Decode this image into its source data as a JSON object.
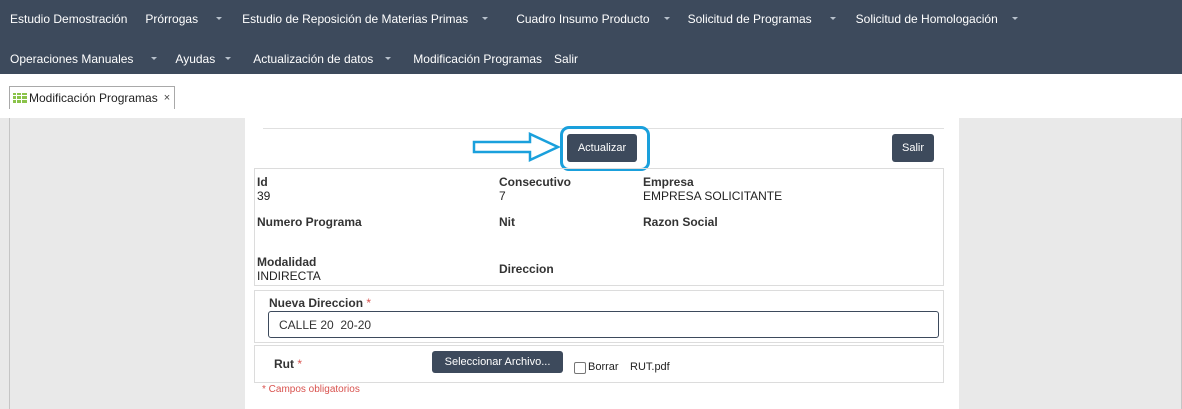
{
  "navbar": {
    "row1": [
      {
        "label": "Estudio Demostración",
        "caret": false
      },
      {
        "label": "Prórrogas",
        "caret": true
      },
      {
        "label": "Estudio de Reposición de Materias Primas",
        "caret": true
      },
      {
        "label": "Cuadro Insumo Producto",
        "caret": true
      },
      {
        "label": "Solicitud de Programas",
        "caret": true
      },
      {
        "label": "Solicitud de Homologación",
        "caret": true
      }
    ],
    "row2": [
      {
        "label": "Operaciones Manuales",
        "caret": true
      },
      {
        "label": "Ayudas",
        "caret": true
      },
      {
        "label": "Actualización de datos",
        "caret": true
      },
      {
        "label": "Modificación Programas",
        "caret": false
      },
      {
        "label": "Salir",
        "caret": false
      }
    ]
  },
  "tab": {
    "label": "Modificación Programas",
    "close": "×",
    "icon": "grid-table-icon"
  },
  "buttons": {
    "update": "Actualizar",
    "exit": "Salir",
    "select_file": "Seleccionar Archivo..."
  },
  "fields": {
    "id_label": "Id",
    "id_value": "39",
    "consecutivo_label": "Consecutivo",
    "consecutivo_value": "7",
    "empresa_label": "Empresa",
    "empresa_value": "EMPRESA SOLICITANTE",
    "numero_programa_label": "Numero Programa",
    "nit_label": "Nit",
    "razon_social_label": "Razon Social",
    "modalidad_label": "Modalidad",
    "modalidad_value": "INDIRECTA",
    "direccion_label": "Direccion",
    "nueva_direccion_label": "Nueva Direccion",
    "nueva_direccion_value": "CALLE 20  20-20",
    "rut_label": "Rut",
    "required_mark": "*",
    "borrar_label": "Borrar",
    "rut_file": "RUT.pdf",
    "required_note": "* Campos obligatorios"
  },
  "colors": {
    "nav_bg": "#3d4a5c",
    "highlight": "#1aa0dc",
    "required": "#d9534f",
    "tab_icon": "#8bc34a"
  }
}
